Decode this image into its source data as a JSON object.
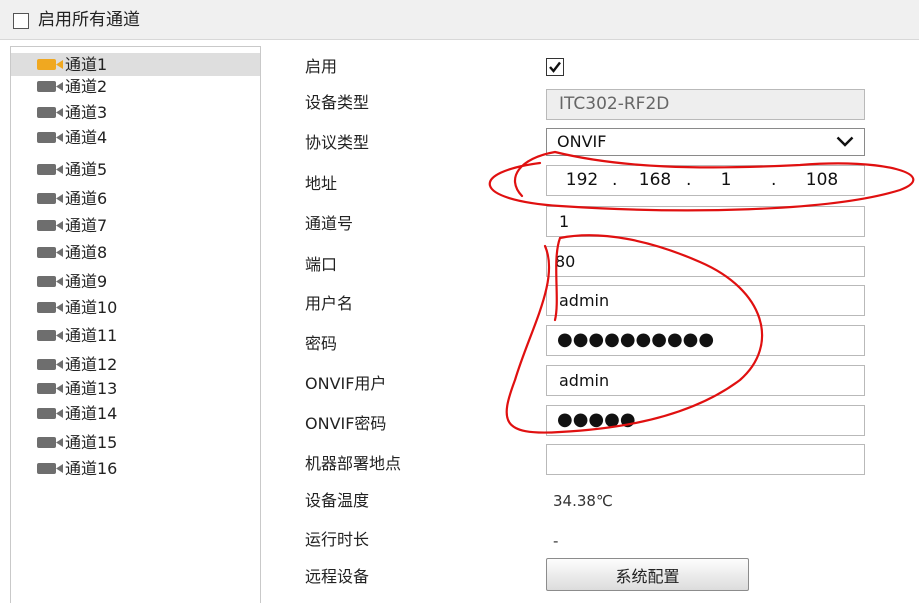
{
  "header": {
    "enable_all_label": "启用所有通道",
    "enable_all_checked": false
  },
  "channels": [
    {
      "label": "通道1"
    },
    {
      "label": "通道2"
    },
    {
      "label": "通道3"
    },
    {
      "label": "通道4"
    },
    {
      "label": "通道5"
    },
    {
      "label": "通道6"
    },
    {
      "label": "通道7"
    },
    {
      "label": "通道8"
    },
    {
      "label": "通道9"
    },
    {
      "label": "通道10"
    },
    {
      "label": "通道11"
    },
    {
      "label": "通道12"
    },
    {
      "label": "通道13"
    },
    {
      "label": "通道14"
    },
    {
      "label": "通道15"
    },
    {
      "label": "通道16"
    }
  ],
  "selected_channel": "通道1",
  "form": {
    "enable": {
      "label": "启用",
      "checked": true
    },
    "device_type": {
      "label": "设备类型",
      "value": "ITC302-RF2D"
    },
    "protocol": {
      "label": "协议类型",
      "value": "ONVIF"
    },
    "address": {
      "label": "地址",
      "octets": [
        "192",
        "168",
        "1",
        "108"
      ]
    },
    "channel_no": {
      "label": "通道号",
      "value": "1"
    },
    "port": {
      "label": "端口",
      "value": "80"
    },
    "username": {
      "label": "用户名",
      "value": "admin"
    },
    "password": {
      "label": "密码",
      "masked": "●●●●●●●●●●"
    },
    "onvif_user": {
      "label": "ONVIF用户",
      "value": "admin"
    },
    "onvif_password": {
      "label": "ONVIF密码",
      "masked": "●●●●●"
    },
    "location": {
      "label": "机器部署地点",
      "value": ""
    },
    "temperature": {
      "label": "设备温度",
      "value": "34.38℃"
    },
    "uptime": {
      "label": "运行时长",
      "value": "-"
    },
    "remote_device": {
      "label": "远程设备",
      "button_label": "系统配置"
    }
  },
  "colors": {
    "selected_camera_icon": "#f0a820",
    "camera_icon": "#6e6e6e",
    "annotation_ink": "#e01010"
  }
}
